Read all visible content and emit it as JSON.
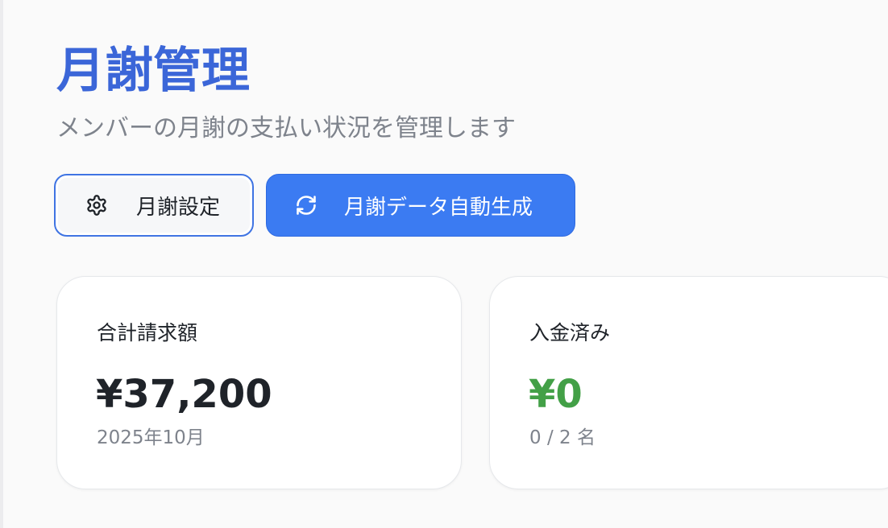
{
  "header": {
    "title": "月謝管理",
    "subtitle": "メンバーの月謝の支払い状況を管理します"
  },
  "actions": {
    "settings_label": "月謝設定",
    "settings_icon": "gear-icon",
    "generate_label": "月謝データ自動生成",
    "generate_icon": "refresh-icon"
  },
  "cards": {
    "total": {
      "label": "合計請求額",
      "value": "¥37,200",
      "sub": "2025年10月"
    },
    "paid": {
      "label": "入金済み",
      "value": "¥0",
      "sub": "0 / 2 名"
    }
  },
  "colors": {
    "accent": "#3b66d8",
    "primary_button": "#3b7bf2",
    "paid_value": "#43a047",
    "muted_text": "#7e838c"
  }
}
